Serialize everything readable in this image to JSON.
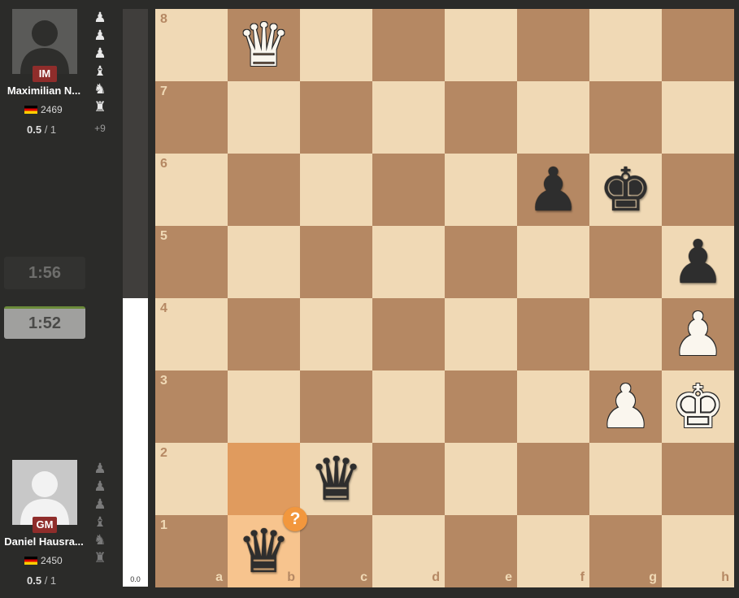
{
  "players": {
    "top": {
      "title": "IM",
      "name": "Maximilian N...",
      "rating": "2469",
      "score_main": "0.5",
      "score_rest": " / 1",
      "captured": [
        "♟",
        "♟",
        "♟",
        "♝",
        "♞",
        "♜"
      ],
      "advantage": "+9"
    },
    "bottom": {
      "title": "GM",
      "name": "Daniel Hausra...",
      "rating": "2450",
      "score_main": "0.5",
      "score_rest": " / 1",
      "captured": [
        "♟",
        "♟",
        "♟",
        "♝",
        "♞",
        "♜"
      ]
    }
  },
  "clocks": {
    "top": "1:56",
    "bottom": "1:52"
  },
  "eval": {
    "value": "0.0",
    "white_fraction": 0.5
  },
  "board": {
    "files": [
      "a",
      "b",
      "c",
      "d",
      "e",
      "f",
      "g",
      "h"
    ],
    "ranks": [
      "8",
      "7",
      "6",
      "5",
      "4",
      "3",
      "2",
      "1"
    ],
    "pieces": [
      {
        "square": "b8",
        "glyph": "♛",
        "color": "w",
        "name": "white-queen"
      },
      {
        "square": "f6",
        "glyph": "♟",
        "color": "b",
        "name": "black-pawn"
      },
      {
        "square": "g6",
        "glyph": "♚",
        "color": "b",
        "name": "black-king"
      },
      {
        "square": "h5",
        "glyph": "♟",
        "color": "b",
        "name": "black-pawn"
      },
      {
        "square": "h4",
        "glyph": "♟",
        "color": "w",
        "name": "white-pawn"
      },
      {
        "square": "g3",
        "glyph": "♟",
        "color": "w",
        "name": "white-pawn"
      },
      {
        "square": "h3",
        "glyph": "♚",
        "color": "w",
        "name": "white-king"
      },
      {
        "square": "c2",
        "glyph": "♛",
        "color": "b",
        "name": "black-queen"
      },
      {
        "square": "b1",
        "glyph": "♛",
        "color": "b",
        "name": "black-queen"
      }
    ],
    "highlights": [
      "b2",
      "b1"
    ],
    "annotation": {
      "square": "b1",
      "symbol": "?"
    }
  }
}
